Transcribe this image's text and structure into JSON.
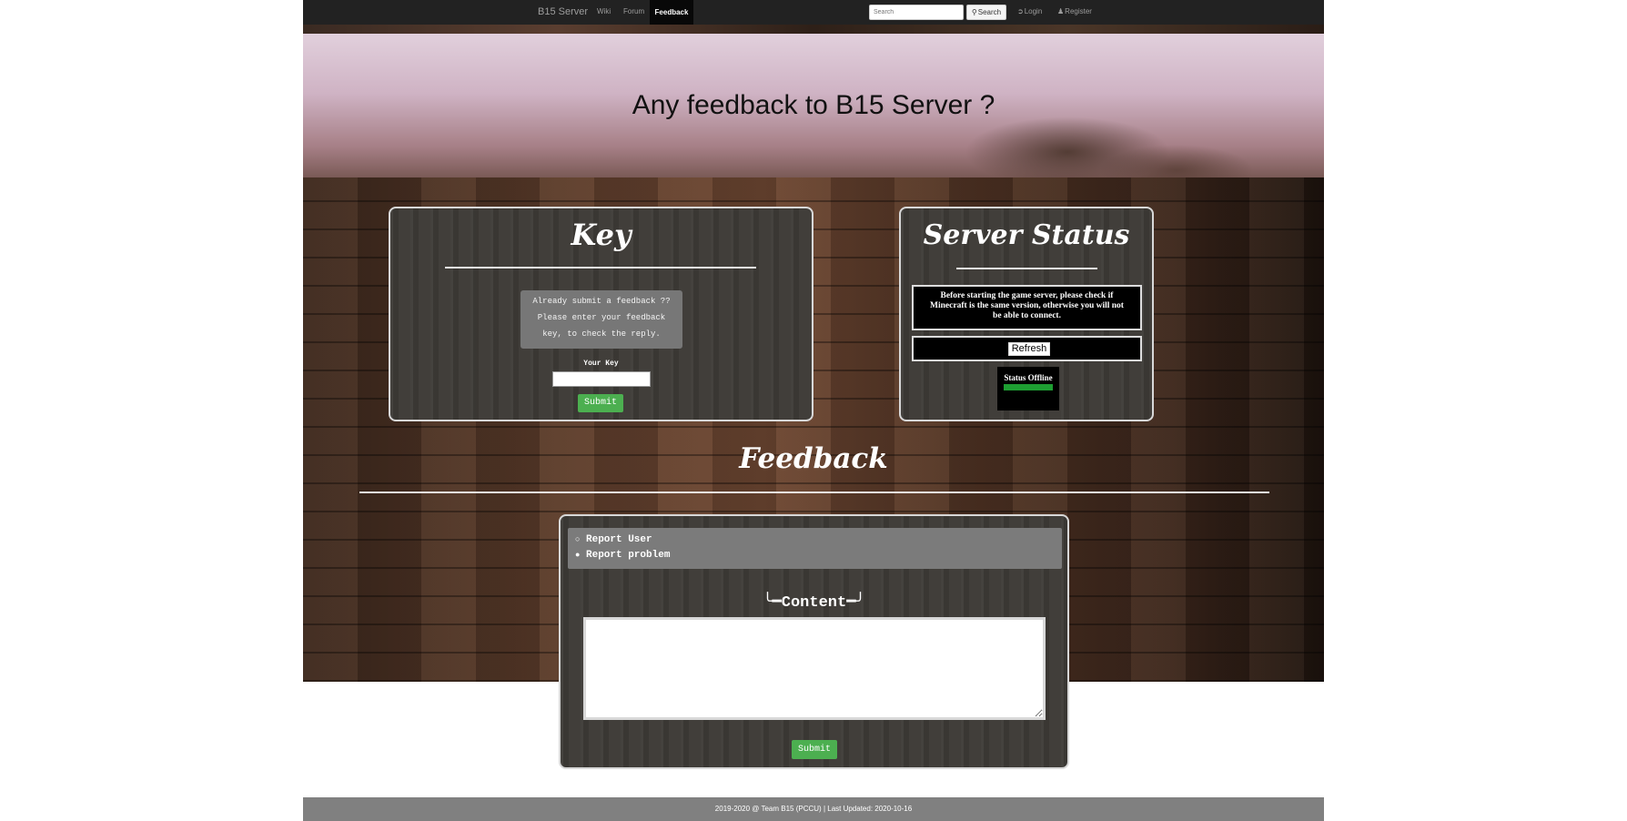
{
  "navbar": {
    "brand": "B15 Server",
    "links": [
      "Wiki",
      "Forum"
    ],
    "active": "Feedback",
    "search_placeholder": "Search",
    "search_button": "Search",
    "login": "Login",
    "register": "Register"
  },
  "hero": {
    "title": "Any feedback to B15 Server ?"
  },
  "key_panel": {
    "title": "Key",
    "note_lines": [
      "Already submit a feedback ??",
      "Please enter your feedback",
      "key, to check the reply."
    ],
    "field_label": "Your Key",
    "field_value": "",
    "submit": "Submit"
  },
  "status_panel": {
    "title": "Server Status",
    "notice_lines": [
      "Before starting the game server, please check if",
      "Minecraft is the same version, otherwise you will not",
      "be able to connect."
    ],
    "refresh": "Refresh",
    "status": "Status Offline",
    "status_color": "#1e9e32"
  },
  "feedback": {
    "title": "Feedback",
    "options": [
      {
        "label": "Report User",
        "selected": false
      },
      {
        "label": "Report problem",
        "selected": true
      }
    ],
    "content_label": "╰━Content━╯",
    "content_value": "",
    "submit": "Submit"
  },
  "footer": {
    "text": "2019-2020 @ Team B15 (PCCU) | Last Updated: 2020-10-16"
  },
  "colors": {
    "accent_green": "#4caf50",
    "navbar": "#222222"
  }
}
